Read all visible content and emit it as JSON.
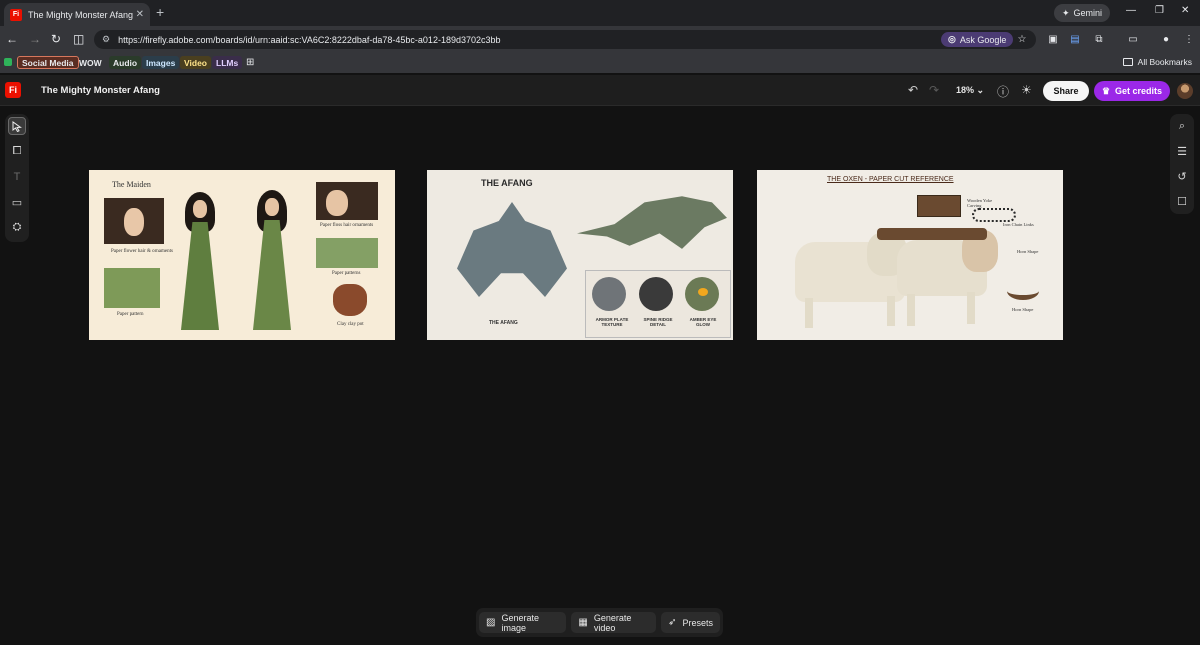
{
  "browser": {
    "tab_title": "The Mighty Monster Afang",
    "gemini_label": "Gemini",
    "url": "https://firefly.adobe.com/boards/id/urn:aaid:sc:VA6C2:8222dbaf-da78-45bc-a012-189d3702c3bb",
    "ask_google_label": "Ask Google",
    "bookmarks": [
      {
        "label": "Social Media",
        "color": "#5a2d22",
        "border": "#d7775d"
      },
      {
        "label": "WOW",
        "color": "transparent",
        "text": "#e8eaed"
      },
      {
        "label": "Audio",
        "color": "#2a3b2a",
        "text": "#e8eaed"
      },
      {
        "label": "Images",
        "color": "#2b3d4a",
        "text": "#cde7ff"
      },
      {
        "label": "Video",
        "color": "#4a3f1f",
        "text": "#ffe48a"
      },
      {
        "label": "LLMs",
        "color": "#3a2d4a",
        "text": "#e1cfff"
      }
    ],
    "all_bookmarks_label": "All Bookmarks"
  },
  "app": {
    "logo_text": "Fi",
    "board_title": "The Mighty Monster Afang",
    "zoom": "18%",
    "share_label": "Share",
    "credits_label": "Get credits",
    "accent": "#9b28e8"
  },
  "cards": [
    {
      "title": "The Maiden",
      "labels": [
        "Paper flower hair & ornaments",
        "Paper floss hair ornaments",
        "Paper patterns",
        "Paper pattern",
        "Clay clay pot"
      ]
    },
    {
      "title": "THE AFANG",
      "caption": "THE AFANG",
      "details": [
        "ARMOR PLATE TEXTURE",
        "SPINE RIDGE DETAIL",
        "AMBER EYE GLOW"
      ]
    },
    {
      "title": "THE OXEN - PAPER CUT REFERENCE",
      "labels": [
        "Wooden Yoke Carving",
        "Iron Chain Links",
        "Horn Shape",
        "Horn Shape"
      ]
    }
  ],
  "bottom_bar": {
    "generate_image": "Generate image",
    "generate_video": "Generate video",
    "presets": "Presets"
  }
}
